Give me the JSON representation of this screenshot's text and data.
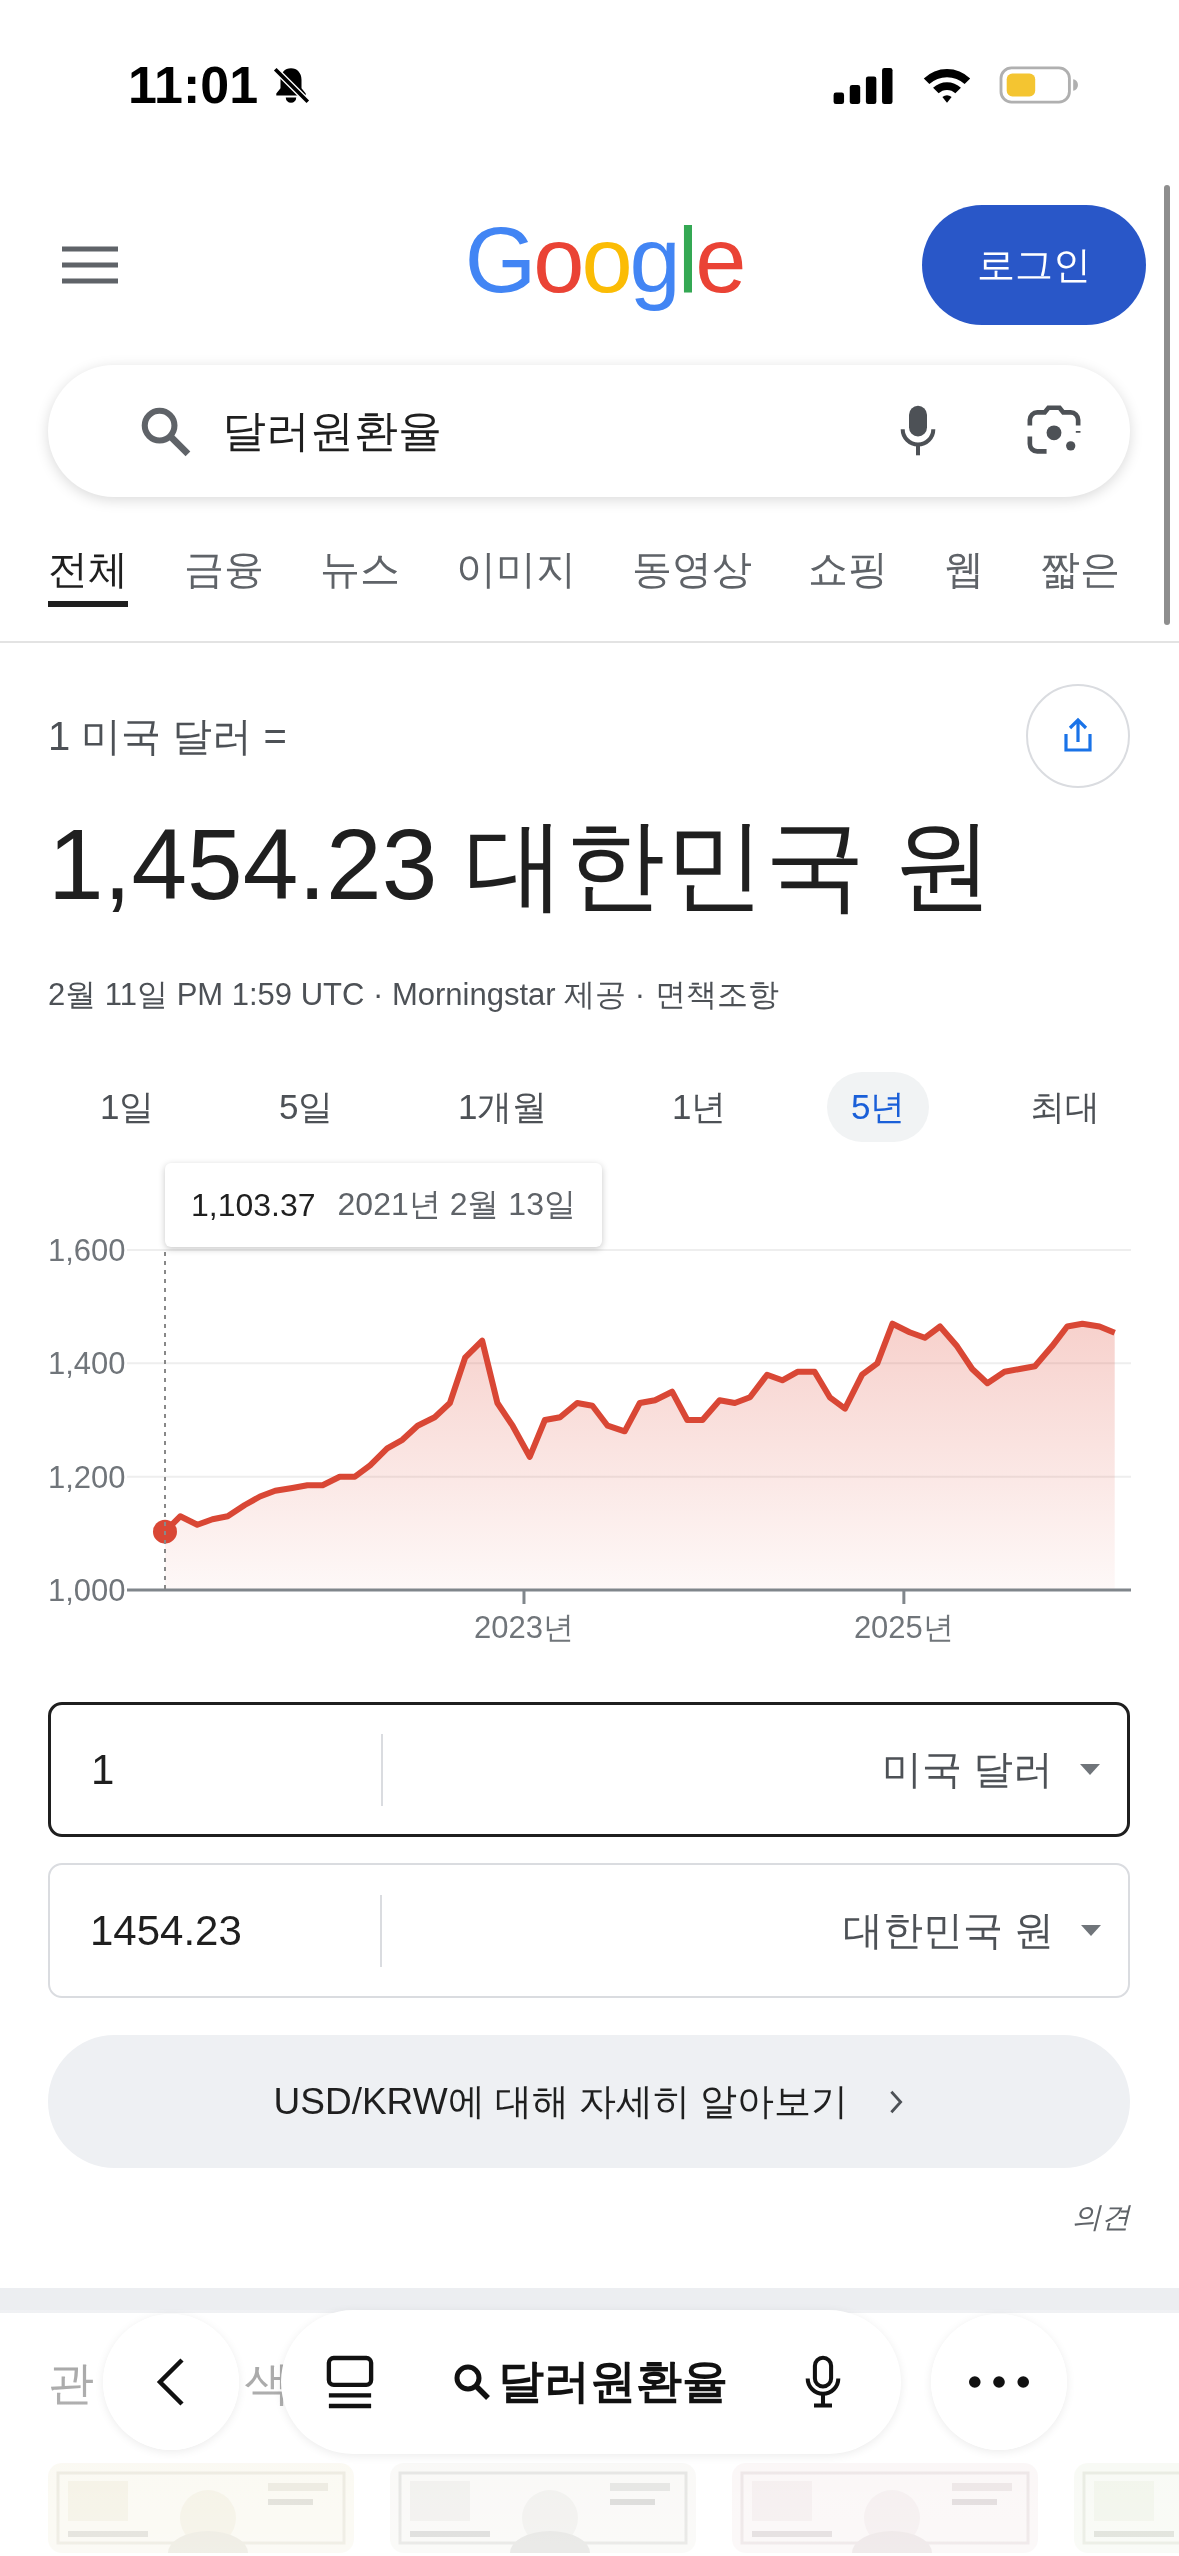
{
  "status_bar": {
    "time": "11:01",
    "silent": true
  },
  "header": {
    "logo": "Google",
    "login_button": "로그인"
  },
  "search": {
    "value": "달러원환율"
  },
  "tabs": [
    {
      "label": "전체",
      "selected": true
    },
    {
      "label": "금융",
      "selected": false
    },
    {
      "label": "뉴스",
      "selected": false
    },
    {
      "label": "이미지",
      "selected": false
    },
    {
      "label": "동영상",
      "selected": false
    },
    {
      "label": "쇼핑",
      "selected": false
    },
    {
      "label": "웹",
      "selected": false
    },
    {
      "label": "짧은",
      "selected": false
    }
  ],
  "conversion": {
    "from_label": "1 미국 달러 =",
    "result": "1,454.23 대한민국 원",
    "source": "2월 11일 PM 1:59 UTC · Morningstar 제공 ·",
    "disclaimer_link": "면책조항"
  },
  "ranges": [
    {
      "label": "1일",
      "selected": false
    },
    {
      "label": "5일",
      "selected": false
    },
    {
      "label": "1개월",
      "selected": false
    },
    {
      "label": "1년",
      "selected": false
    },
    {
      "label": "5년",
      "selected": true
    },
    {
      "label": "최대",
      "selected": false
    }
  ],
  "chart": {
    "tooltip": {
      "value": "1,103.37",
      "date": "2021년 2월 13일"
    },
    "chart_data": {
      "type": "area",
      "x": [
        2021.11,
        2021.19,
        2021.28,
        2021.36,
        2021.44,
        2021.53,
        2021.61,
        2021.69,
        2021.78,
        2021.86,
        2021.94,
        2022.03,
        2022.11,
        2022.19,
        2022.28,
        2022.36,
        2022.44,
        2022.53,
        2022.61,
        2022.69,
        2022.78,
        2022.86,
        2022.94,
        2023.03,
        2023.11,
        2023.19,
        2023.28,
        2023.36,
        2023.44,
        2023.53,
        2023.61,
        2023.69,
        2023.78,
        2023.86,
        2023.94,
        2024.03,
        2024.11,
        2024.19,
        2024.28,
        2024.36,
        2024.44,
        2024.53,
        2024.61,
        2024.69,
        2024.78,
        2024.86,
        2024.94,
        2025.03,
        2025.11,
        2025.19,
        2025.28,
        2025.36,
        2025.44,
        2025.53,
        2025.61,
        2025.69,
        2025.78,
        2025.86,
        2025.94,
        2026.03,
        2026.11
      ],
      "series": [
        {
          "color": "#d94735",
          "values": [
            1103,
            1130,
            1115,
            1125,
            1130,
            1150,
            1165,
            1175,
            1180,
            1185,
            1185,
            1200,
            1200,
            1220,
            1250,
            1265,
            1290,
            1305,
            1330,
            1410,
            1440,
            1330,
            1290,
            1235,
            1300,
            1305,
            1330,
            1325,
            1290,
            1280,
            1330,
            1335,
            1350,
            1300,
            1300,
            1335,
            1330,
            1340,
            1380,
            1370,
            1385,
            1385,
            1340,
            1320,
            1380,
            1400,
            1470,
            1455,
            1445,
            1465,
            1430,
            1390,
            1365,
            1385,
            1390,
            1395,
            1430,
            1465,
            1470,
            1465,
            1454
          ]
        }
      ],
      "xlim": [
        2020.91,
        2026.18
      ],
      "ylim": [
        1000,
        1600
      ],
      "yticks": [
        {
          "value": 1000,
          "label": "1,000"
        },
        {
          "value": 1200,
          "label": "1,200"
        },
        {
          "value": 1400,
          "label": "1,400"
        },
        {
          "value": 1600,
          "label": "1,600"
        }
      ],
      "xticks": [
        {
          "value": 2023,
          "label": "2023년"
        },
        {
          "value": 2025,
          "label": "2025년"
        }
      ]
    }
  },
  "converter": [
    {
      "value": "1",
      "currency": "미국 달러",
      "focused": true
    },
    {
      "value": "1454.23",
      "currency": "대한민국 원",
      "focused": false
    }
  ],
  "learn_more": "USD/KRW에 대해 자세히 알아보기",
  "feedback": "의견",
  "related": {
    "heading_fragments": [
      "관",
      "색"
    ]
  },
  "bottom_bar": {
    "query": "달러원환율"
  }
}
